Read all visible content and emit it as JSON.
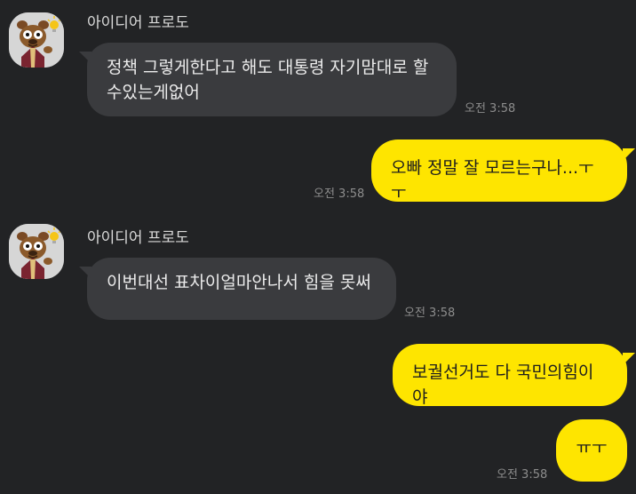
{
  "colors": {
    "background": "#222325",
    "incoming_bubble": "#3a3b3e",
    "outgoing_bubble": "#fee500",
    "timestamp": "#8d8d8d"
  },
  "messages": [
    {
      "direction": "incoming",
      "sender": "아이디어 프로도",
      "text": "정책 그렇게한다고 해도 대통령 자기맘대로 할\n수있는게없어",
      "time": "오전 3:58",
      "avatar_icon": "frodo-character-avatar"
    },
    {
      "direction": "outgoing",
      "text": "오빠 정말 잘 모르는구나...ㅜㅜ",
      "time": "오전 3:58"
    },
    {
      "direction": "incoming",
      "sender": "아이디어 프로도",
      "text": "이번대선 표차이얼마안나서 힘을 못써",
      "time": "오전 3:58",
      "avatar_icon": "frodo-character-avatar"
    },
    {
      "direction": "outgoing",
      "text": "보궐선거도 다 국민의힘이야",
      "time": ""
    },
    {
      "direction": "outgoing",
      "text": "ㅠㅜ",
      "time": "오전 3:58"
    }
  ]
}
